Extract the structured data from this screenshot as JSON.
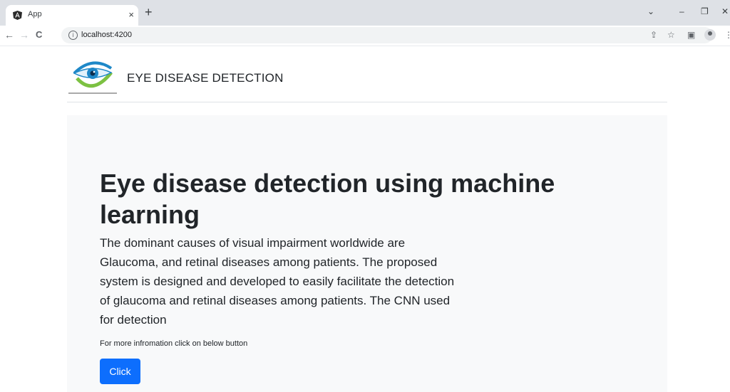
{
  "browser": {
    "tab": {
      "title": "App",
      "close": "×"
    },
    "new_tab": "+",
    "window_controls": {
      "dropdown": "⌄",
      "minimize": "–",
      "restore": "❐",
      "close": "✕"
    },
    "nav": {
      "back": "←",
      "forward": "→",
      "reload": "C"
    },
    "url": "localhost:4200",
    "icons": [
      "share-icon",
      "star-icon",
      "side-panel-icon",
      "profile-icon",
      "menu-icon"
    ]
  },
  "navbar": {
    "brand": "EYE DISEASE DETECTION"
  },
  "hero": {
    "title": "Eye disease detection using machine learning",
    "lead": "The dominant causes of visual impairment worldwide are Glaucoma, and retinal diseases among patients. The proposed system is designed and developed to easily facilitate the detection of glaucoma and retinal diseases among patients. The CNN used for detection",
    "small_text": "For more infromation click on below button",
    "button": "Click"
  },
  "colors": {
    "primary": "#0d6efd",
    "jumbotron_bg": "#f8f9fa",
    "tabbar_bg": "#dee1e6"
  }
}
